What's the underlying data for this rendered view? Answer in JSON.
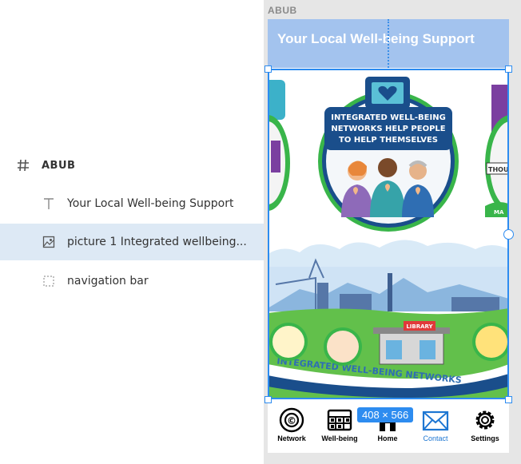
{
  "layers": {
    "group_name": "ABUB",
    "items": [
      {
        "icon": "text-icon",
        "label": "Your Local Well-being Support"
      },
      {
        "icon": "image-icon",
        "label": "picture 1 Integrated wellbeing..."
      },
      {
        "icon": "dashed-box-icon",
        "label": "navigation bar"
      }
    ]
  },
  "canvas": {
    "artboard_label": "ABUB",
    "title": "Your Local Well-being Support",
    "poster": {
      "headline_lines": [
        "INTEGRATED WELL-BEING",
        "NETWORKS HELP PEOPLE",
        "TO HELP THEMSELVES"
      ],
      "banner": "INTEGRATED WELL-BEING NETWORKS",
      "library_sign": "LIBRARY",
      "side_sign": "THOU",
      "side_sign_right": "MA"
    },
    "selection_size": "408 × 566",
    "nav": [
      {
        "label": "Network",
        "icon": "network-icon"
      },
      {
        "label": "Well-being",
        "icon": "grid-icon"
      },
      {
        "label": "Home",
        "icon": "home-icon"
      },
      {
        "label": "Contact",
        "icon": "mail-icon"
      },
      {
        "label": "Settings",
        "icon": "gear-icon"
      }
    ]
  },
  "colors": {
    "accent": "#2d8cf0",
    "title_bg": "#a3c3ee",
    "selected_layer": "#dde9f5",
    "nav_active": "#1d76d2"
  }
}
